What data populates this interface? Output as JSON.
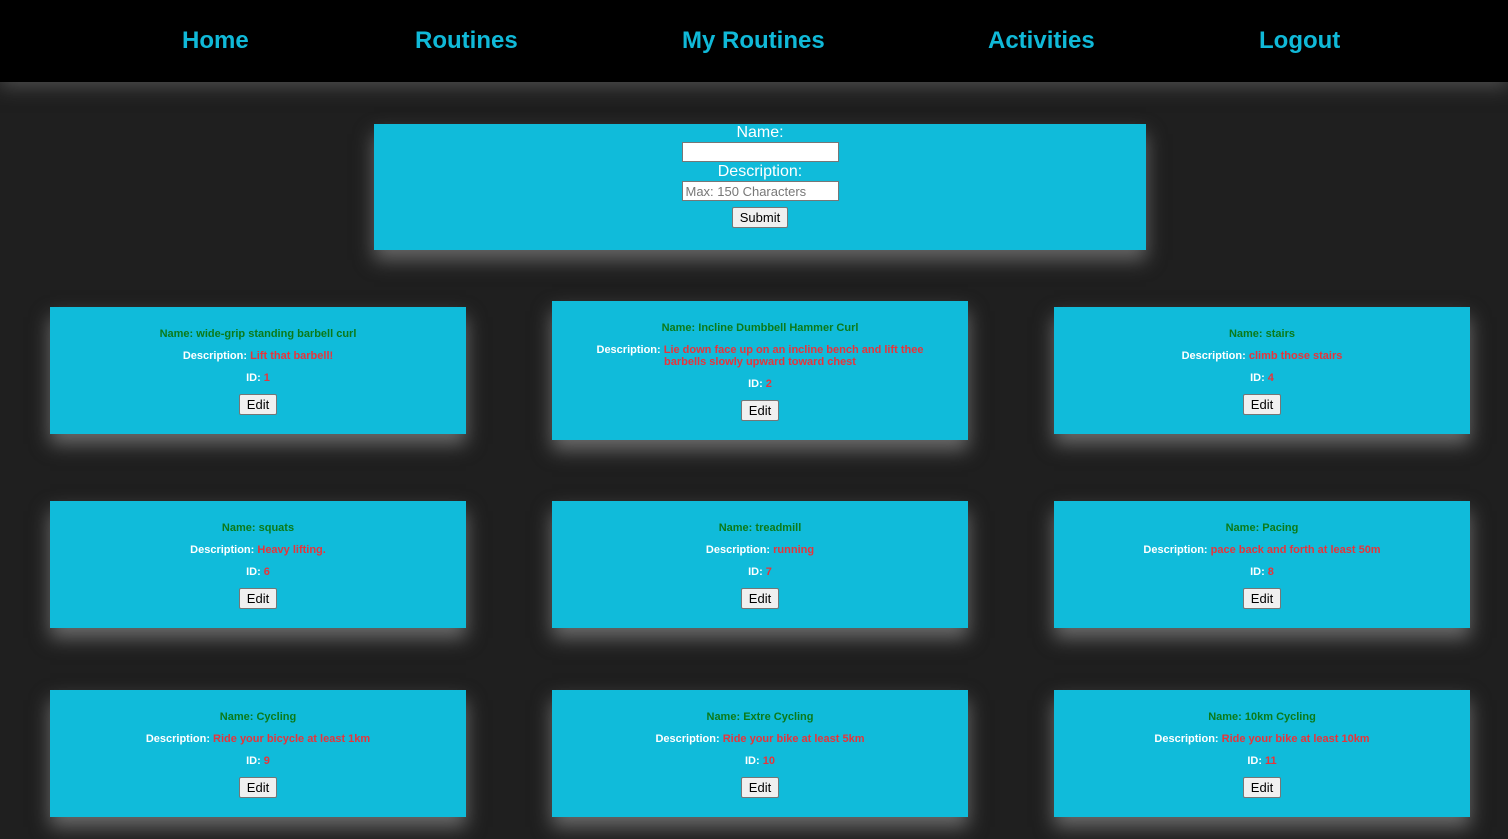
{
  "nav": {
    "items": [
      {
        "label": "Home"
      },
      {
        "label": "Routines"
      },
      {
        "label": "My Routines"
      },
      {
        "label": "Activities"
      },
      {
        "label": "Logout"
      }
    ]
  },
  "form": {
    "name_label": "Name:",
    "name_value": "",
    "description_label": "Description:",
    "description_placeholder": "Max: 150 Characters",
    "submit_label": "Submit"
  },
  "activities": {
    "name_prefix": "Name: ",
    "description_prefix": "Description: ",
    "id_prefix": "ID: ",
    "edit_label": "Edit",
    "items": [
      {
        "name": "wide-grip standing barbell curl",
        "description": "Lift that barbell!",
        "id": "1"
      },
      {
        "name": "Incline Dumbbell Hammer Curl",
        "description": "Lie down face up on an incline bench and lift thee barbells slowly upward toward chest",
        "id": "2"
      },
      {
        "name": "stairs",
        "description": "climb those stairs",
        "id": "4"
      },
      {
        "name": "squats",
        "description": "Heavy lifting.",
        "id": "6"
      },
      {
        "name": "treadmill",
        "description": "running",
        "id": "7"
      },
      {
        "name": "Pacing",
        "description": "pace back and forth at least 50m",
        "id": "8"
      },
      {
        "name": "Cycling",
        "description": "Ride your bicycle at least 1km",
        "id": "9"
      },
      {
        "name": "Extre Cycling",
        "description": "Ride your bike at least 5km",
        "id": "10"
      },
      {
        "name": "10km Cycling",
        "description": "Ride your bike at least 10km",
        "id": "11"
      }
    ]
  },
  "colors": {
    "nav_bg": "#000000",
    "nav_link": "#10b9d8",
    "page_bg": "#1f1f1f",
    "card_bg": "#10bbda",
    "name_text": "#0b7a1a",
    "value_text": "#e8343a"
  }
}
